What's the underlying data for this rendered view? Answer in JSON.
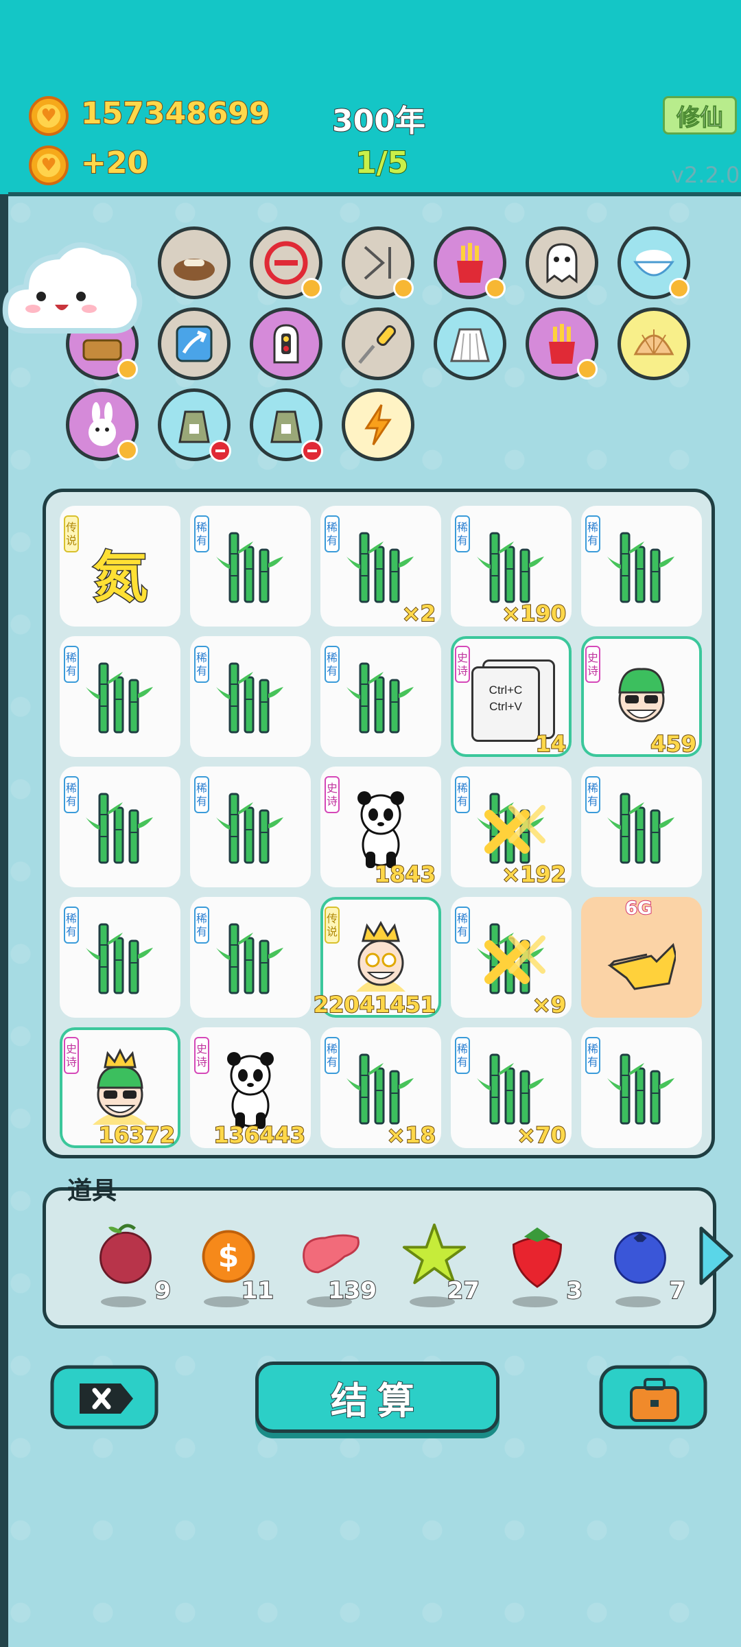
{
  "header": {
    "coins": "157348699",
    "income": "+20",
    "years": "300年",
    "progress": "1/5",
    "xiuxian_button": "修仙",
    "version": "v2.2.0"
  },
  "relics": [
    {
      "icon": "dog-bowl-icon",
      "bg": "#d9d0c2"
    },
    {
      "icon": "no-entry-icon",
      "bg": "#d9d0c2"
    },
    {
      "icon": "skip-icon",
      "bg": "#d9d0c2"
    },
    {
      "icon": "fries-icon",
      "bg": "#d58ad9"
    },
    {
      "icon": "ghost-icon",
      "bg": "#d9d0c2"
    },
    {
      "icon": "rice-bowl-icon",
      "bg": "#9fe3ee"
    },
    {
      "icon": "basket-icon",
      "bg": "#d58ad9"
    },
    {
      "icon": "rising-arrow-icon",
      "bg": "#d9d0c2"
    },
    {
      "icon": "traffic-light-icon",
      "bg": "#d58ad9"
    },
    {
      "icon": "screwdriver-icon",
      "bg": "#d9d0c2"
    },
    {
      "icon": "skirt-icon",
      "bg": "#9fe3ee"
    },
    {
      "icon": "fries-icon",
      "bg": "#d58ad9"
    },
    {
      "icon": "shell-icon",
      "bg": "#f8ef8a"
    },
    {
      "icon": "rabbit-icon",
      "bg": "#d58ad9"
    },
    {
      "icon": "sack-icon",
      "bg": "#9fe3ee"
    },
    {
      "icon": "sack-icon",
      "bg": "#9fe3ee"
    },
    {
      "icon": "lightning-icon",
      "bg": "#fff3c4"
    }
  ],
  "tags": {
    "rare": "稀有",
    "epic": "史诗",
    "legend": "传说"
  },
  "board": [
    {
      "tag": "legend",
      "item": "nitrogen",
      "glyph": "氮",
      "count": ""
    },
    {
      "tag": "rare",
      "item": "bamboo",
      "count": ""
    },
    {
      "tag": "rare",
      "item": "bamboo",
      "count": "×2"
    },
    {
      "tag": "rare",
      "item": "bamboo",
      "count": "×190"
    },
    {
      "tag": "rare",
      "item": "bamboo",
      "count": ""
    },
    {
      "tag": "rare",
      "item": "bamboo",
      "count": ""
    },
    {
      "tag": "rare",
      "item": "bamboo",
      "count": ""
    },
    {
      "tag": "rare",
      "item": "bamboo",
      "count": ""
    },
    {
      "tag": "epic",
      "item": "ctrl-cv",
      "text1": "Ctrl+C",
      "text2": "Ctrl+V",
      "count": "14"
    },
    {
      "tag": "epic",
      "item": "man-green-cap",
      "count": "459"
    },
    {
      "tag": "rare",
      "item": "bamboo",
      "count": ""
    },
    {
      "tag": "rare",
      "item": "bamboo",
      "count": ""
    },
    {
      "tag": "epic",
      "item": "panda",
      "count": "1843"
    },
    {
      "tag": "rare",
      "item": "bamboo-hit",
      "count": "×192"
    },
    {
      "tag": "rare",
      "item": "bamboo",
      "count": ""
    },
    {
      "tag": "rare",
      "item": "bamboo",
      "count": ""
    },
    {
      "tag": "rare",
      "item": "bamboo",
      "count": ""
    },
    {
      "tag": "legend",
      "item": "king",
      "count": "22041451"
    },
    {
      "tag": "rare",
      "item": "bamboo-hit",
      "count": "×9"
    },
    {
      "tag": "",
      "item": "pointer",
      "label": "6G",
      "count": ""
    },
    {
      "tag": "epic",
      "item": "king-cap",
      "count": "16372"
    },
    {
      "tag": "epic",
      "item": "panda",
      "count": "136443"
    },
    {
      "tag": "rare",
      "item": "bamboo",
      "count": "×18"
    },
    {
      "tag": "rare",
      "item": "bamboo",
      "count": "×70"
    },
    {
      "tag": "rare",
      "item": "bamboo",
      "count": ""
    }
  ],
  "props": {
    "label": "道具",
    "items": [
      {
        "icon": "lychee-icon",
        "count": "9"
      },
      {
        "icon": "coin-icon",
        "count": "11"
      },
      {
        "icon": "liver-icon",
        "count": "139"
      },
      {
        "icon": "star-icon",
        "count": "27"
      },
      {
        "icon": "strawberry-icon",
        "count": "3"
      },
      {
        "icon": "blueberry-icon",
        "count": "7"
      }
    ]
  },
  "buttons": {
    "settle": "结算"
  }
}
